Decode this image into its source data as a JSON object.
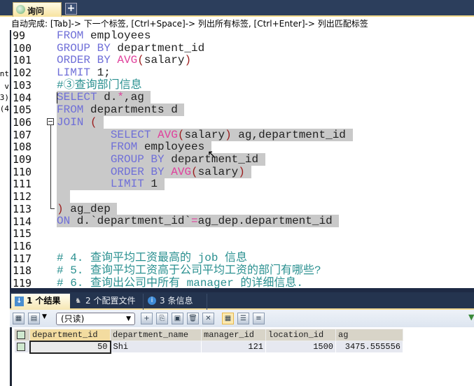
{
  "editor_tab": {
    "label": "询问",
    "add_label": "+"
  },
  "hint": "自动完成: [Tab]-> 下一个标签, [Ctrl+Space]-> 列出所有标签, [Ctrl+Enter]-> 列出匹配标签",
  "left_strip": [
    "nt",
    "v",
    "3)",
    "(4"
  ],
  "line_numbers": [
    "99",
    "100",
    "101",
    "102",
    "103",
    "104",
    "105",
    "106",
    "107",
    "108",
    "109",
    "110",
    "111",
    "112",
    "113",
    "114",
    "115",
    "116",
    "117",
    "118",
    "119"
  ],
  "code_lines": [
    {
      "sel": false,
      "tokens": [
        [
          "FROM",
          "k"
        ],
        [
          " employees",
          "t"
        ]
      ]
    },
    {
      "sel": false,
      "tokens": [
        [
          "GROUP BY",
          "k"
        ],
        [
          " department_id",
          "t"
        ]
      ]
    },
    {
      "sel": false,
      "tokens": [
        [
          "ORDER BY",
          "k"
        ],
        [
          " ",
          "t"
        ],
        [
          "AVG",
          "f"
        ],
        [
          "(",
          "p"
        ],
        [
          "salary",
          "t"
        ],
        [
          ")",
          "p"
        ]
      ]
    },
    {
      "sel": false,
      "tokens": [
        [
          "LIMIT",
          "k"
        ],
        [
          " 1;",
          "t"
        ]
      ]
    },
    {
      "sel": false,
      "tokens": [
        [
          "#③查询部门信息",
          "c"
        ]
      ]
    },
    {
      "sel": true,
      "tokens": [
        [
          "SELECT",
          "k"
        ],
        [
          " d.",
          "t"
        ],
        [
          "*",
          "f"
        ],
        [
          ",ag ",
          "t"
        ]
      ]
    },
    {
      "sel": true,
      "tokens": [
        [
          "FROM",
          "k"
        ],
        [
          " departments d ",
          "t"
        ]
      ]
    },
    {
      "sel": true,
      "tokens": [
        [
          "JOIN",
          "k"
        ],
        [
          " ",
          "t"
        ],
        [
          "(",
          "p"
        ],
        [
          " ",
          "t"
        ]
      ]
    },
    {
      "sel": true,
      "tokens": [
        [
          "        SELECT",
          "k"
        ],
        [
          " ",
          "t"
        ],
        [
          "AVG",
          "f"
        ],
        [
          "(",
          "p"
        ],
        [
          "salary",
          "t"
        ],
        [
          ")",
          "p"
        ],
        [
          " ag,department_id ",
          "t"
        ]
      ]
    },
    {
      "sel": true,
      "tokens": [
        [
          "        FROM",
          "k"
        ],
        [
          " employees ",
          "t"
        ]
      ]
    },
    {
      "sel": true,
      "tokens": [
        [
          "        GROUP BY",
          "k"
        ],
        [
          " department_id ",
          "t"
        ]
      ]
    },
    {
      "sel": true,
      "tokens": [
        [
          "        ORDER BY",
          "k"
        ],
        [
          " ",
          "t"
        ],
        [
          "AVG",
          "f"
        ],
        [
          "(",
          "p"
        ],
        [
          "salary",
          "t"
        ],
        [
          ")",
          "p"
        ],
        [
          " ",
          "t"
        ]
      ]
    },
    {
      "sel": true,
      "tokens": [
        [
          "        LIMIT",
          "k"
        ],
        [
          " 1 ",
          "t"
        ]
      ]
    },
    {
      "sel": true,
      "tokens": [
        [
          "  ",
          "t"
        ]
      ]
    },
    {
      "sel": true,
      "tokens": [
        [
          ")",
          "p"
        ],
        [
          " ag_dep ",
          "t"
        ]
      ]
    },
    {
      "sel": true,
      "tokens": [
        [
          "ON",
          "k"
        ],
        [
          " d.`department_id`",
          "t"
        ],
        [
          "=",
          "f"
        ],
        [
          "ag_dep.department_id ",
          "t"
        ]
      ]
    },
    {
      "sel": false,
      "tokens": [
        [
          "",
          "t"
        ]
      ]
    },
    {
      "sel": false,
      "tokens": [
        [
          "",
          "t"
        ]
      ]
    },
    {
      "sel": false,
      "tokens": [
        [
          "# 4. 查询平均工资最高的 job 信息",
          "c"
        ]
      ]
    },
    {
      "sel": false,
      "tokens": [
        [
          "# 5. 查询平均工资高于公司平均工资的部门有哪些?",
          "c"
        ]
      ]
    },
    {
      "sel": false,
      "tokens": [
        [
          "# 6. 查询出公司中所有 manager 的详细信息.",
          "c"
        ]
      ]
    }
  ],
  "result_tabs": [
    {
      "label": "1 个结果",
      "icon": "result-icon",
      "active": true
    },
    {
      "label": "2 个配置文件",
      "icon": "profile-icon",
      "active": false
    },
    {
      "label": "3 条信息",
      "icon": "info-icon",
      "active": false
    }
  ],
  "toolbar": {
    "mode": "(只读)"
  },
  "grid": {
    "columns": [
      "department_id",
      "department_name",
      "manager_id",
      "location_id",
      "ag"
    ],
    "rows": [
      [
        "50",
        "Shi",
        "121",
        "1500",
        "3475.555556"
      ]
    ]
  }
}
